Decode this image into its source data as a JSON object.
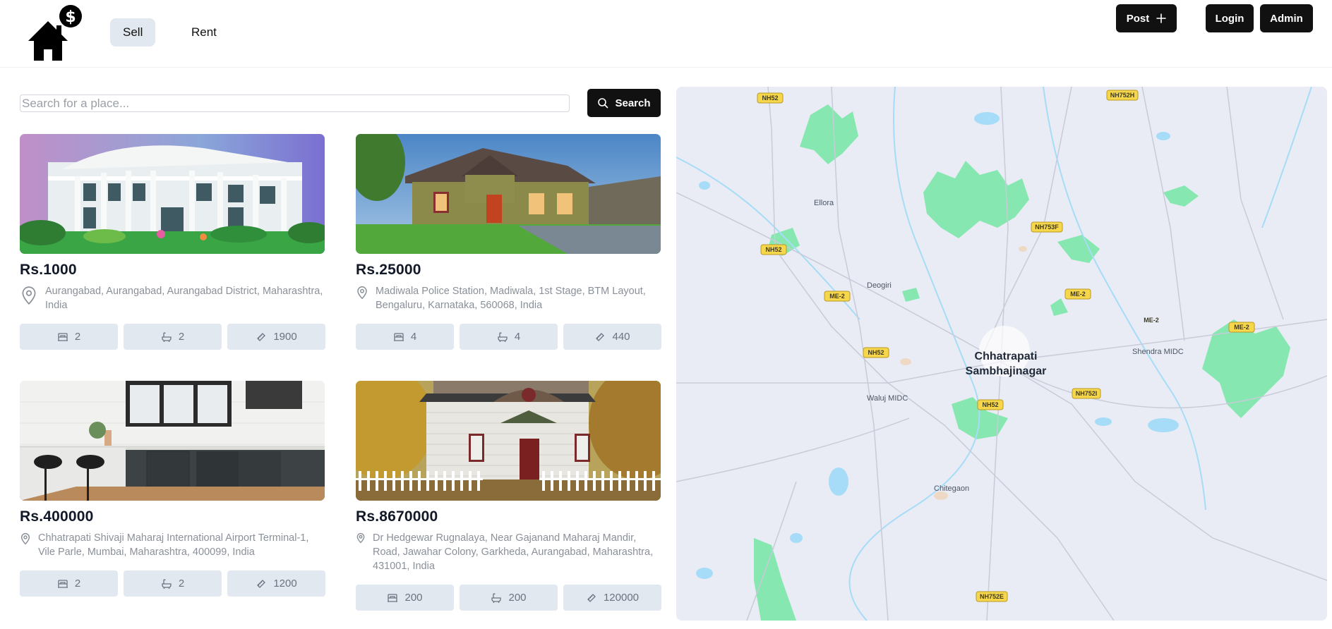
{
  "header": {
    "nav": [
      {
        "label": "Sell",
        "active": true
      },
      {
        "label": "Rent",
        "active": false
      }
    ],
    "post_label": "Post",
    "login_label": "Login",
    "admin_label": "Admin"
  },
  "search": {
    "placeholder": "Search for a place...",
    "value": "",
    "button_label": "Search"
  },
  "listings": [
    {
      "price": "Rs.1000",
      "address": "Aurangabad, Aurangabad, Aurangabad District, Maharashtra, India",
      "bedrooms": "2",
      "bathrooms": "2",
      "area": "1900",
      "image": "white-mansion"
    },
    {
      "price": "Rs.25000",
      "address": "Madiwala Police Station, Madiwala, 1st Stage, BTM Layout, Bengaluru, Karnataka, 560068, India",
      "bedrooms": "4",
      "bathrooms": "4",
      "area": "440",
      "image": "suburban-house"
    },
    {
      "price": "Rs.400000",
      "address": "Chhatrapati Shivaji Maharaj International Airport Terminal-1, Vile Parle, Mumbai, Maharashtra, 400099, India",
      "bedrooms": "2",
      "bathrooms": "2",
      "area": "1200",
      "image": "kitchen-interior"
    },
    {
      "price": "Rs.8670000",
      "address": "Dr Hedgewar Rugnalaya, Near Gajanand Maharaj Mandir, Road, Jawahar Colony, Garkheda, Aurangabad, Maharashtra, 431001, India",
      "bedrooms": "200",
      "bathrooms": "200",
      "area": "120000",
      "image": "white-cottage"
    }
  ],
  "map": {
    "city": [
      "Chhatrapati",
      "Sambhajinagar"
    ],
    "places": [
      "Ellora",
      "Deogiri",
      "Waluj MIDC",
      "Shendra MIDC",
      "Chitegaon"
    ],
    "road_shields": [
      "NH52",
      "NH752H",
      "NH753F",
      "NH52",
      "ME-2",
      "ME-2",
      "ME-2",
      "ME-2",
      "NH52",
      "NH752I",
      "NH52",
      "NH752E"
    ]
  },
  "colors": {
    "primary_button": "#111111",
    "chip_bg": "#e2e8f0",
    "active_nav_bg": "#e2e8f0",
    "map_bg": "#e9ecf5",
    "map_forest": "#86e8b0",
    "map_water": "#a6dcf7",
    "road_shield": "#f6d64a"
  }
}
